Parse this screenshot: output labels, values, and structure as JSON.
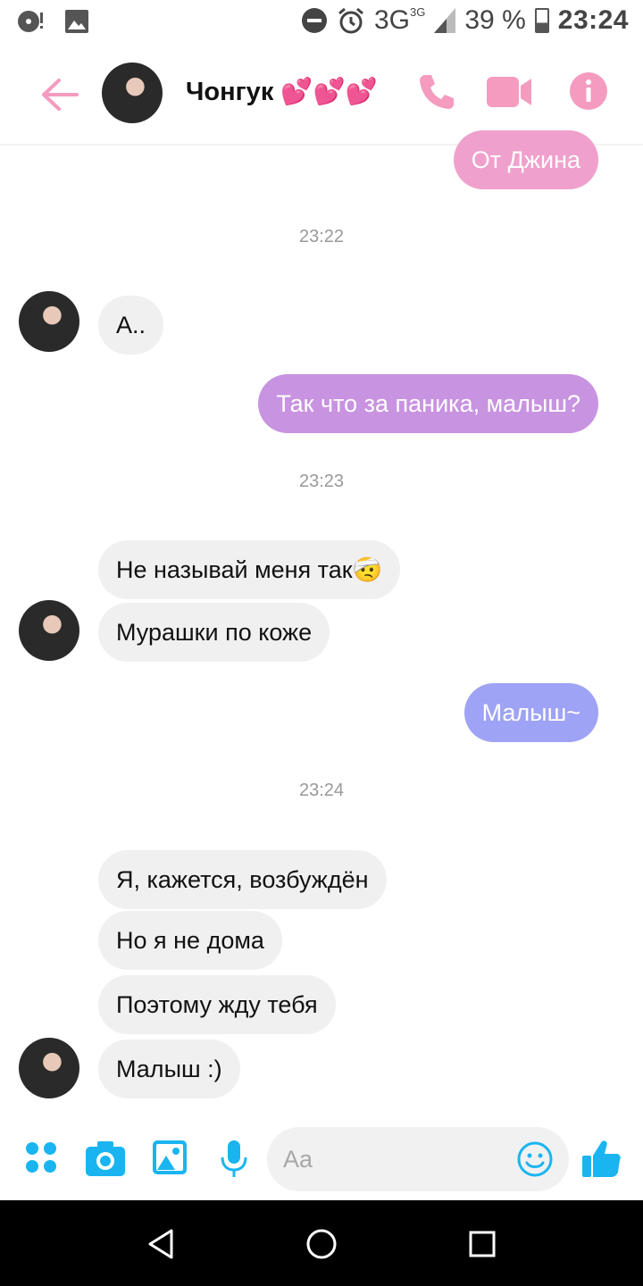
{
  "status_bar": {
    "network": "3G",
    "network_small": "3G",
    "battery": "39 %",
    "time": "23:24"
  },
  "header": {
    "contact_name": "Чонгук 💕💕💕"
  },
  "colors": {
    "accent": "#f07fb0",
    "outgoing_pink": "#f0a0cc",
    "outgoing_purple": "#c893e0",
    "outgoing_blue": "#9ea3f5",
    "messenger_blue": "#1ab5f0"
  },
  "messages": [
    {
      "id": "m1",
      "direction": "out",
      "text": "От Джина"
    },
    {
      "id": "ts1",
      "type": "timestamp",
      "text": "23:22"
    },
    {
      "id": "m2",
      "direction": "in",
      "text": "А.."
    },
    {
      "id": "m3",
      "direction": "out",
      "text": "Так что за паника, малыш?"
    },
    {
      "id": "ts2",
      "type": "timestamp",
      "text": "23:23"
    },
    {
      "id": "m4",
      "direction": "in",
      "text": "Не называй меня так🤕"
    },
    {
      "id": "m5",
      "direction": "in",
      "text": "Мурашки по коже"
    },
    {
      "id": "m6",
      "direction": "out",
      "text": "Малыш~"
    },
    {
      "id": "ts3",
      "type": "timestamp",
      "text": "23:24"
    },
    {
      "id": "m7",
      "direction": "in",
      "text": "Я, кажется, возбуждён"
    },
    {
      "id": "m8",
      "direction": "in",
      "text": "Но я не дома"
    },
    {
      "id": "m9",
      "direction": "in",
      "text": "Поэтому жду тебя"
    },
    {
      "id": "m10",
      "direction": "in",
      "text": "Малыш :)"
    }
  ],
  "composer": {
    "placeholder": "Aa"
  },
  "icons": {
    "back": "arrow-left-icon",
    "call": "phone-icon",
    "video": "video-camera-icon",
    "info": "info-icon",
    "menu": "four-dots-icon",
    "camera": "camera-icon",
    "gallery": "image-icon",
    "mic": "microphone-icon",
    "emoji": "smiley-icon",
    "like": "thumbs-up-icon"
  }
}
